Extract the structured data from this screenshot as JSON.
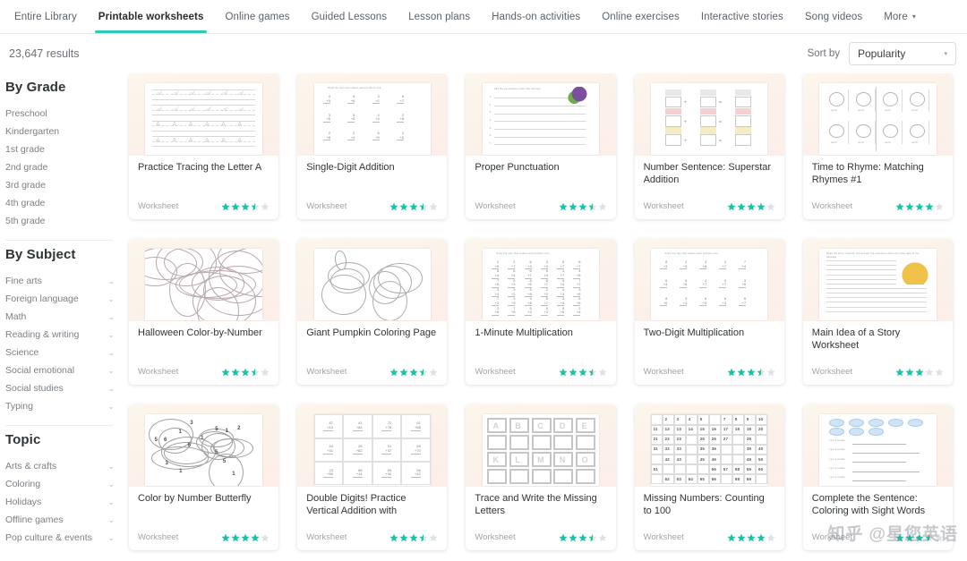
{
  "nav": {
    "tabs": [
      {
        "label": "Entire Library",
        "active": false
      },
      {
        "label": "Printable worksheets",
        "active": true
      },
      {
        "label": "Online games",
        "active": false
      },
      {
        "label": "Guided Lessons",
        "active": false
      },
      {
        "label": "Lesson plans",
        "active": false
      },
      {
        "label": "Hands-on activities",
        "active": false
      },
      {
        "label": "Online exercises",
        "active": false
      },
      {
        "label": "Interactive stories",
        "active": false
      },
      {
        "label": "Song videos",
        "active": false
      },
      {
        "label": "More",
        "active": false,
        "caret": "▾"
      }
    ]
  },
  "results": {
    "count_label": "23,647 results",
    "sort_label": "Sort by",
    "sort_value": "Popularity",
    "sort_arrow": "▾"
  },
  "sidebar": {
    "sections": [
      {
        "title": "By Grade",
        "items": [
          {
            "label": "Preschool",
            "chevron": false
          },
          {
            "label": "Kindergarten",
            "chevron": false
          },
          {
            "label": "1st grade",
            "chevron": false
          },
          {
            "label": "2nd grade",
            "chevron": false
          },
          {
            "label": "3rd grade",
            "chevron": false
          },
          {
            "label": "4th grade",
            "chevron": false
          },
          {
            "label": "5th grade",
            "chevron": false
          }
        ]
      },
      {
        "title": "By Subject",
        "items": [
          {
            "label": "Fine arts",
            "chevron": true
          },
          {
            "label": "Foreign language",
            "chevron": true
          },
          {
            "label": "Math",
            "chevron": true
          },
          {
            "label": "Reading & writing",
            "chevron": true
          },
          {
            "label": "Science",
            "chevron": true
          },
          {
            "label": "Social emotional",
            "chevron": true
          },
          {
            "label": "Social studies",
            "chevron": true
          },
          {
            "label": "Typing",
            "chevron": true
          }
        ]
      },
      {
        "title": "Topic",
        "items": [
          {
            "label": "Arts & crafts",
            "chevron": true
          },
          {
            "label": "Coloring",
            "chevron": true
          },
          {
            "label": "Holidays",
            "chevron": true
          },
          {
            "label": "Offline games",
            "chevron": true
          },
          {
            "label": "Pop culture & events",
            "chevron": true
          }
        ]
      }
    ],
    "chevron_glyph": "⌄"
  },
  "cards": [
    {
      "title": "Practice Tracing the Letter A",
      "type": "Worksheet",
      "rating": 3.5,
      "art": "tracing"
    },
    {
      "title": "Single-Digit Addition",
      "type": "Worksheet",
      "rating": 3.5,
      "art": "addition"
    },
    {
      "title": "Proper Punctuation",
      "type": "Worksheet",
      "rating": 3.5,
      "art": "punctuation"
    },
    {
      "title": "Number Sentence: Superstar Addition",
      "type": "Worksheet",
      "rating": 4.0,
      "art": "numbersentence"
    },
    {
      "title": "Time to Rhyme: Matching Rhymes #1",
      "type": "Worksheet",
      "rating": 4.0,
      "art": "rhyme"
    },
    {
      "title": "Halloween Color-by-Number",
      "type": "Worksheet",
      "rating": 3.5,
      "art": "halloween"
    },
    {
      "title": "Giant Pumpkin Coloring Page",
      "type": "Worksheet",
      "rating": 3.5,
      "art": "pumpkin"
    },
    {
      "title": "1-Minute Multiplication",
      "type": "Worksheet",
      "rating": 3.5,
      "art": "multiplication"
    },
    {
      "title": "Two-Digit Multiplication",
      "type": "Worksheet",
      "rating": 3.5,
      "art": "twodigit"
    },
    {
      "title": "Main Idea of a Story Worksheet",
      "type": "Worksheet",
      "rating": 3.0,
      "art": "mainidea"
    },
    {
      "title": "Color by Number Butterfly",
      "type": "Worksheet",
      "rating": 4.0,
      "art": "butterfly"
    },
    {
      "title": "Double Digits! Practice Vertical Addition with",
      "type": "Worksheet",
      "rating": 3.5,
      "art": "doubledigits"
    },
    {
      "title": "Trace and Write the Missing Letters",
      "type": "Worksheet",
      "rating": 3.5,
      "art": "traceletters"
    },
    {
      "title": "Missing Numbers: Counting to 100",
      "type": "Worksheet",
      "rating": 4.0,
      "art": "missingnumbers"
    },
    {
      "title": "Complete the Sentence: Coloring with Sight Words",
      "type": "Worksheet",
      "rating": 3.5,
      "art": "sentence"
    }
  ],
  "watermark": {
    "brand": "知乎",
    "handle": "@星您英语"
  },
  "colors": {
    "accent": "#31c8b4",
    "star_filled": "#19c3a8",
    "star_empty": "#dfe2e4",
    "text_primary": "#2f3437",
    "text_muted": "#7b8085"
  }
}
